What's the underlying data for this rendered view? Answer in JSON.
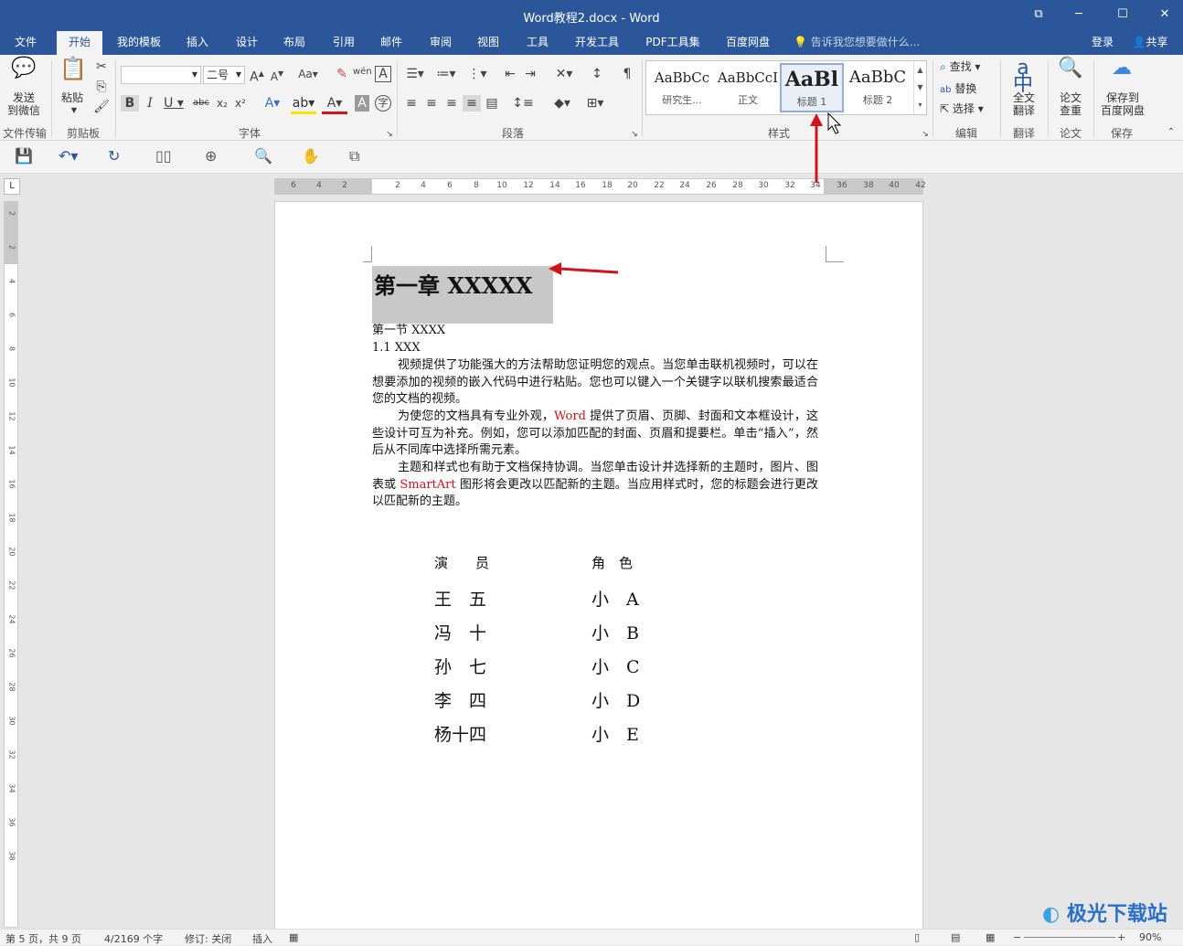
{
  "window": {
    "title": "Word教程2.docx - Word"
  },
  "tabs": [
    "文件",
    "开始",
    "我的模板",
    "插入",
    "设计",
    "布局",
    "引用",
    "邮件",
    "审阅",
    "视图",
    "工具",
    "开发工具",
    "PDF工具集",
    "百度网盘"
  ],
  "active_tab": "开始",
  "tell_me": "告诉我您想要做什么...",
  "account": {
    "login": "登录",
    "share": "共享"
  },
  "ribbon": {
    "send_wechat": {
      "line1": "发送",
      "line2": "到微信",
      "group": "文件传输"
    },
    "paste": {
      "label": "粘贴",
      "group": "剪贴板"
    },
    "font": {
      "size": "二号",
      "group": "字体"
    },
    "paragraph": {
      "group": "段落"
    },
    "styles": {
      "group": "样式",
      "items": [
        {
          "preview": "AaBbCc",
          "name": "研究生..."
        },
        {
          "preview": "AaBbCcI",
          "name": "正文"
        },
        {
          "preview": "AaBl",
          "name": "标题 1"
        },
        {
          "preview": "AaBbC",
          "name": "标题 2"
        }
      ]
    },
    "editing": {
      "find": "查找",
      "replace": "替换",
      "select": "选择",
      "group": "编辑"
    },
    "translate": {
      "line1": "全文",
      "line2": "翻译",
      "group": "翻译"
    },
    "paper": {
      "line1": "论文",
      "line2": "查重",
      "group": "论文"
    },
    "save": {
      "line1": "保存到",
      "line2": "百度网盘",
      "group": "保存"
    }
  },
  "ruler": {
    "h_ticks": [
      "6",
      "4",
      "2",
      "2",
      "4",
      "6",
      "8",
      "10",
      "12",
      "14",
      "16",
      "18",
      "20",
      "22",
      "24",
      "26",
      "28",
      "30",
      "32",
      "34",
      "36",
      "38",
      "40",
      "42"
    ],
    "v_ticks": [
      "2",
      "2",
      "4",
      "6",
      "8",
      "10",
      "12",
      "14",
      "16",
      "18",
      "20",
      "22",
      "24",
      "26",
      "28",
      "30",
      "32",
      "34",
      "36",
      "38"
    ]
  },
  "document": {
    "heading1": "第一章  XXXXX",
    "section": "第一节  XXXX",
    "subsection": "1.1 XXX",
    "p1": "视频提供了功能强大的方法帮助您证明您的观点。当您单击联机视频时，可以在想要添加的视频的嵌入代码中进行粘贴。您也可以键入一个关键字以联机搜索最适合您的文档的视频。",
    "p2_a": "为使您的文档具有专业外观，",
    "p2_word": "Word",
    "p2_b": " 提供了页眉、页脚、封面和文本框设计，这些设计可互为补充。例如，您可以添加匹配的封面、页眉和提要栏。单击“插入”，然后从不同库中选择所需元素。",
    "p3_a": "主题和样式也有助于文档保持协调。当您单击设计并选择新的主题时，图片、图表或 ",
    "p3_smartart": "SmartArt",
    "p3_b": " 图形将会更改以匹配新的主题。当应用样式时，您的标题会进行更改以匹配新的主题。",
    "table": {
      "headers": [
        "演　　员",
        "角　色"
      ],
      "rows": [
        [
          "王　五",
          "小　A"
        ],
        [
          "冯　十",
          "小　B"
        ],
        [
          "孙　七",
          "小　C"
        ],
        [
          "李　四",
          "小　D"
        ],
        [
          "杨十四",
          "小　E"
        ]
      ]
    }
  },
  "status": {
    "page": "第 5 页，共 9 页",
    "words": "4/2169 个字",
    "track": "修订: 关闭",
    "insert": "插入",
    "zoom": "90%"
  },
  "watermark": "极光下载站",
  "colors": {
    "brand": "#2b579a",
    "highlight_arrow": "#d0141b"
  }
}
